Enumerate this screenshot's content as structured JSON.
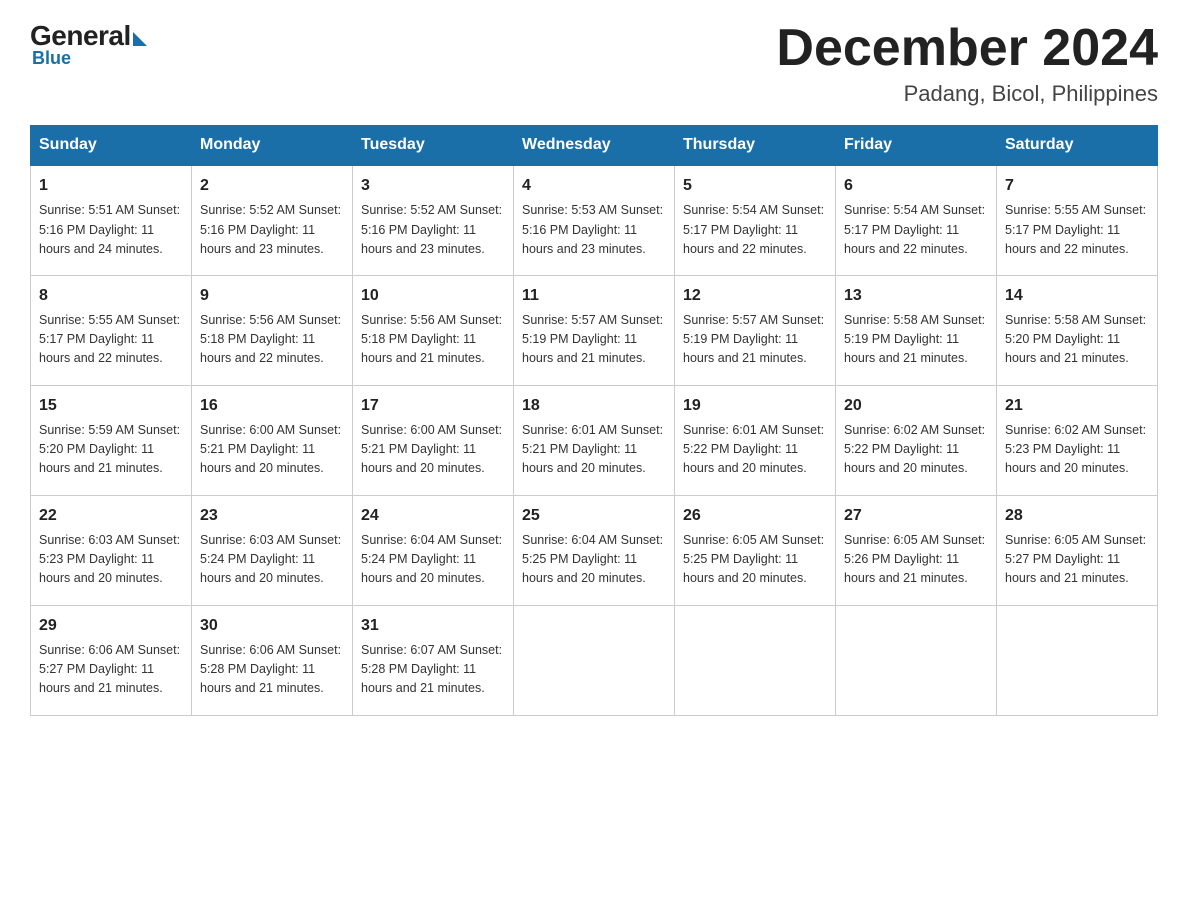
{
  "logo": {
    "general": "General",
    "blue": "Blue"
  },
  "title": "December 2024",
  "location": "Padang, Bicol, Philippines",
  "days_header": [
    "Sunday",
    "Monday",
    "Tuesday",
    "Wednesday",
    "Thursday",
    "Friday",
    "Saturday"
  ],
  "weeks": [
    [
      {
        "num": "1",
        "info": "Sunrise: 5:51 AM\nSunset: 5:16 PM\nDaylight: 11 hours\nand 24 minutes."
      },
      {
        "num": "2",
        "info": "Sunrise: 5:52 AM\nSunset: 5:16 PM\nDaylight: 11 hours\nand 23 minutes."
      },
      {
        "num": "3",
        "info": "Sunrise: 5:52 AM\nSunset: 5:16 PM\nDaylight: 11 hours\nand 23 minutes."
      },
      {
        "num": "4",
        "info": "Sunrise: 5:53 AM\nSunset: 5:16 PM\nDaylight: 11 hours\nand 23 minutes."
      },
      {
        "num": "5",
        "info": "Sunrise: 5:54 AM\nSunset: 5:17 PM\nDaylight: 11 hours\nand 22 minutes."
      },
      {
        "num": "6",
        "info": "Sunrise: 5:54 AM\nSunset: 5:17 PM\nDaylight: 11 hours\nand 22 minutes."
      },
      {
        "num": "7",
        "info": "Sunrise: 5:55 AM\nSunset: 5:17 PM\nDaylight: 11 hours\nand 22 minutes."
      }
    ],
    [
      {
        "num": "8",
        "info": "Sunrise: 5:55 AM\nSunset: 5:17 PM\nDaylight: 11 hours\nand 22 minutes."
      },
      {
        "num": "9",
        "info": "Sunrise: 5:56 AM\nSunset: 5:18 PM\nDaylight: 11 hours\nand 22 minutes."
      },
      {
        "num": "10",
        "info": "Sunrise: 5:56 AM\nSunset: 5:18 PM\nDaylight: 11 hours\nand 21 minutes."
      },
      {
        "num": "11",
        "info": "Sunrise: 5:57 AM\nSunset: 5:19 PM\nDaylight: 11 hours\nand 21 minutes."
      },
      {
        "num": "12",
        "info": "Sunrise: 5:57 AM\nSunset: 5:19 PM\nDaylight: 11 hours\nand 21 minutes."
      },
      {
        "num": "13",
        "info": "Sunrise: 5:58 AM\nSunset: 5:19 PM\nDaylight: 11 hours\nand 21 minutes."
      },
      {
        "num": "14",
        "info": "Sunrise: 5:58 AM\nSunset: 5:20 PM\nDaylight: 11 hours\nand 21 minutes."
      }
    ],
    [
      {
        "num": "15",
        "info": "Sunrise: 5:59 AM\nSunset: 5:20 PM\nDaylight: 11 hours\nand 21 minutes."
      },
      {
        "num": "16",
        "info": "Sunrise: 6:00 AM\nSunset: 5:21 PM\nDaylight: 11 hours\nand 20 minutes."
      },
      {
        "num": "17",
        "info": "Sunrise: 6:00 AM\nSunset: 5:21 PM\nDaylight: 11 hours\nand 20 minutes."
      },
      {
        "num": "18",
        "info": "Sunrise: 6:01 AM\nSunset: 5:21 PM\nDaylight: 11 hours\nand 20 minutes."
      },
      {
        "num": "19",
        "info": "Sunrise: 6:01 AM\nSunset: 5:22 PM\nDaylight: 11 hours\nand 20 minutes."
      },
      {
        "num": "20",
        "info": "Sunrise: 6:02 AM\nSunset: 5:22 PM\nDaylight: 11 hours\nand 20 minutes."
      },
      {
        "num": "21",
        "info": "Sunrise: 6:02 AM\nSunset: 5:23 PM\nDaylight: 11 hours\nand 20 minutes."
      }
    ],
    [
      {
        "num": "22",
        "info": "Sunrise: 6:03 AM\nSunset: 5:23 PM\nDaylight: 11 hours\nand 20 minutes."
      },
      {
        "num": "23",
        "info": "Sunrise: 6:03 AM\nSunset: 5:24 PM\nDaylight: 11 hours\nand 20 minutes."
      },
      {
        "num": "24",
        "info": "Sunrise: 6:04 AM\nSunset: 5:24 PM\nDaylight: 11 hours\nand 20 minutes."
      },
      {
        "num": "25",
        "info": "Sunrise: 6:04 AM\nSunset: 5:25 PM\nDaylight: 11 hours\nand 20 minutes."
      },
      {
        "num": "26",
        "info": "Sunrise: 6:05 AM\nSunset: 5:25 PM\nDaylight: 11 hours\nand 20 minutes."
      },
      {
        "num": "27",
        "info": "Sunrise: 6:05 AM\nSunset: 5:26 PM\nDaylight: 11 hours\nand 21 minutes."
      },
      {
        "num": "28",
        "info": "Sunrise: 6:05 AM\nSunset: 5:27 PM\nDaylight: 11 hours\nand 21 minutes."
      }
    ],
    [
      {
        "num": "29",
        "info": "Sunrise: 6:06 AM\nSunset: 5:27 PM\nDaylight: 11 hours\nand 21 minutes."
      },
      {
        "num": "30",
        "info": "Sunrise: 6:06 AM\nSunset: 5:28 PM\nDaylight: 11 hours\nand 21 minutes."
      },
      {
        "num": "31",
        "info": "Sunrise: 6:07 AM\nSunset: 5:28 PM\nDaylight: 11 hours\nand 21 minutes."
      },
      null,
      null,
      null,
      null
    ]
  ]
}
